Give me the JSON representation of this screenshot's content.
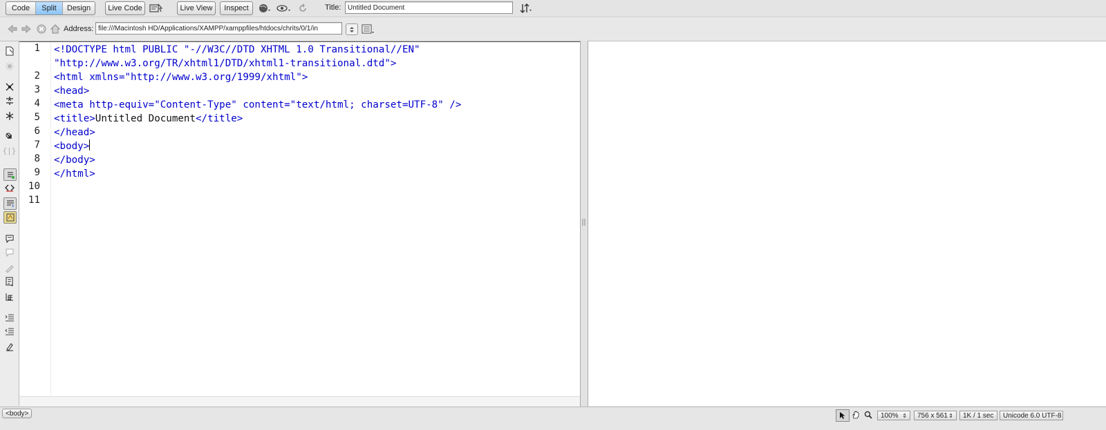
{
  "view_modes": {
    "code": "Code",
    "split": "Split",
    "design": "Design",
    "active": "Split"
  },
  "toolbar": {
    "live_code": "Live Code",
    "live_view": "Live View",
    "inspect": "Inspect",
    "title_label": "Title:",
    "title_value": "Untitled Document"
  },
  "address_bar": {
    "label": "Address:",
    "url": "file:///Macintosh HD/Applications/XAMPP/xamppfiles/htdocs/chrits/0/1/in"
  },
  "code_lines": [
    {
      "num": "1",
      "text": "<!DOCTYPE html PUBLIC \"-//W3C//DTD XHTML 1.0 Transitional//EN\""
    },
    {
      "num": "",
      "text": "\"http://www.w3.org/TR/xhtml1/DTD/xhtml1-transitional.dtd\">"
    },
    {
      "num": "2",
      "text": "<html xmlns=\"http://www.w3.org/1999/xhtml\">"
    },
    {
      "num": "3",
      "text": "<head>"
    },
    {
      "num": "4",
      "text": "<meta http-equiv=\"Content-Type\" content=\"text/html; charset=UTF-8\" />"
    },
    {
      "num": "5",
      "text_open": "<title>",
      "text_inner": "Untitled Document",
      "text_close": "</title>"
    },
    {
      "num": "6",
      "text": "</head>"
    },
    {
      "num": "7",
      "text": "<body>"
    },
    {
      "num": "8",
      "text": ""
    },
    {
      "num": "9",
      "text": "</body>"
    },
    {
      "num": "10",
      "text": "</html>"
    },
    {
      "num": "11",
      "text": ""
    }
  ],
  "status_bar": {
    "tag_selector": "<body>",
    "zoom": "100%",
    "window_size": "756 x 561",
    "file_size": "1K / 1 sec",
    "encoding": "Unicode 6.0 UTF-8"
  },
  "colors": {
    "code_tag": "#0000cc",
    "active_tab": "#8cc4f5"
  }
}
